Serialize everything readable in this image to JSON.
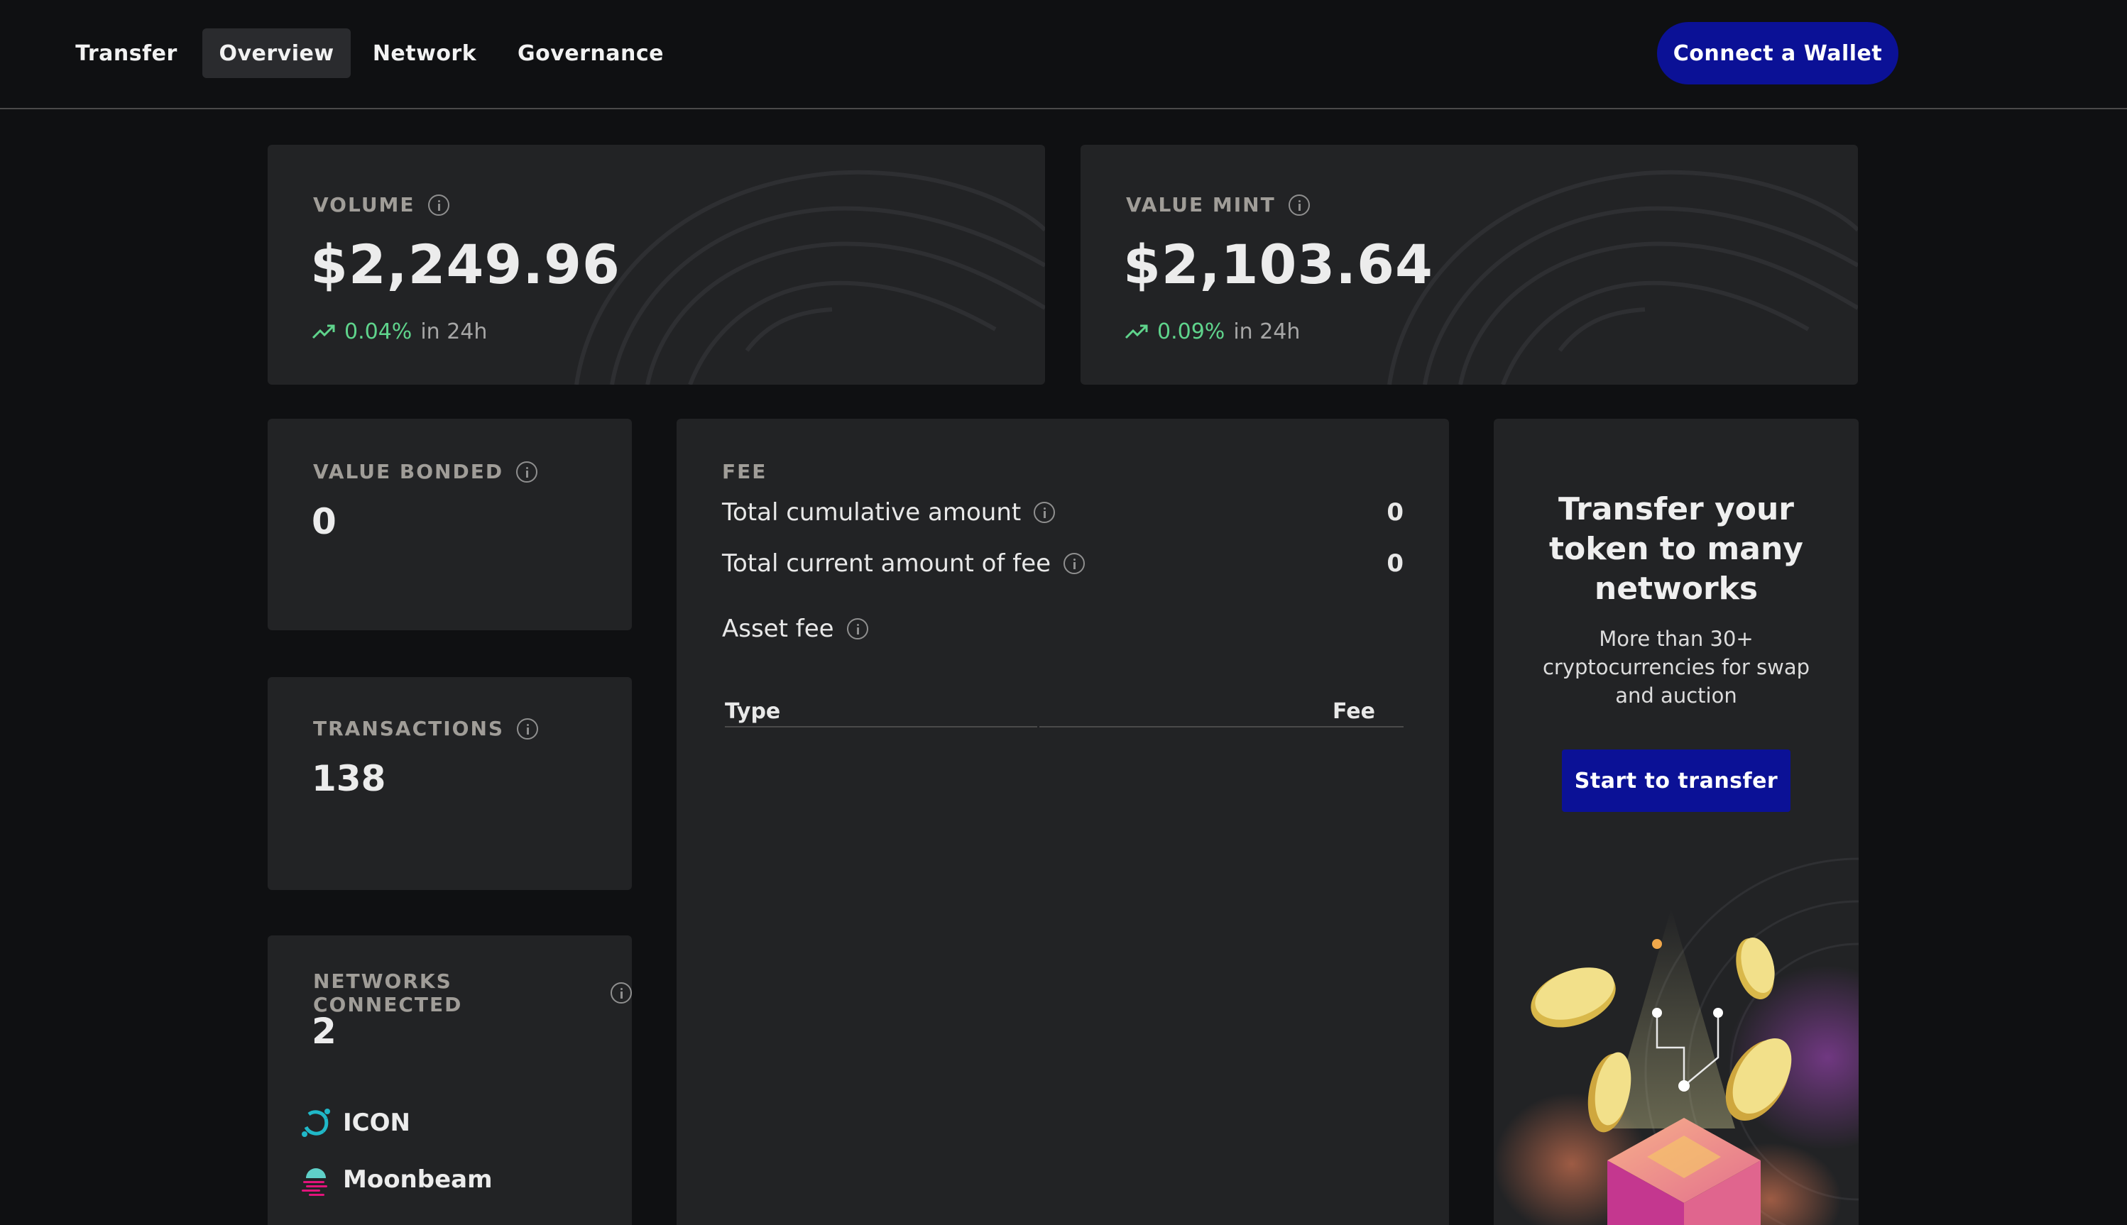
{
  "nav": {
    "tabs": [
      {
        "label": "Transfer",
        "active": false
      },
      {
        "label": "Overview",
        "active": true
      },
      {
        "label": "Network",
        "active": false
      },
      {
        "label": "Governance",
        "active": false
      }
    ],
    "connect_wallet_label": "Connect a Wallet"
  },
  "volume": {
    "label": "VOLUME",
    "value": "$2,249.96",
    "change_pct": "0.04%",
    "change_suffix": "in 24h"
  },
  "value_mint": {
    "label": "VALUE MINT",
    "value": "$2,103.64",
    "change_pct": "0.09%",
    "change_suffix": "in 24h"
  },
  "value_bonded": {
    "label": "VALUE BONDED",
    "value": "0"
  },
  "transactions": {
    "label": "TRANSACTIONS",
    "value": "138"
  },
  "networks_connected": {
    "label": "NETWORKS CONNECTED",
    "value": "2",
    "networks": [
      {
        "name": "ICON",
        "icon": "icon-network-logo"
      },
      {
        "name": "Moonbeam",
        "icon": "moonbeam-network-logo"
      }
    ]
  },
  "fee": {
    "label": "FEE",
    "total_cumulative_label": "Total cumulative amount",
    "total_cumulative_value": "0",
    "total_current_label": "Total current amount of fee",
    "total_current_value": "0",
    "asset_fee_label": "Asset fee",
    "table_headers": {
      "type": "Type",
      "fee": "Fee"
    },
    "rows": []
  },
  "promo": {
    "title": "Transfer your token to many networks",
    "subtitle": "More than 30+ cryptocurrencies for swap and auction",
    "button_label": "Start to transfer"
  },
  "colors": {
    "background": "#0f1012",
    "card": "#222325",
    "accent_button": "#0b1196",
    "positive_change": "#5fd48c"
  }
}
